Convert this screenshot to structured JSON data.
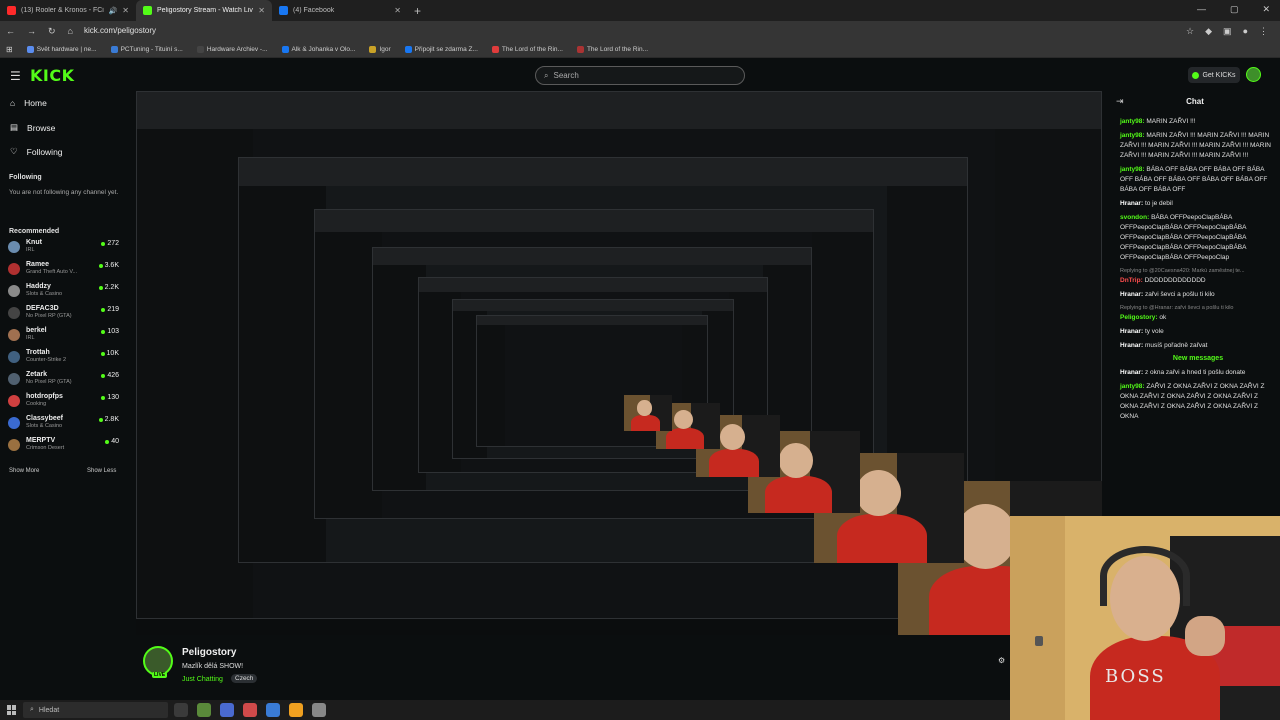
{
  "browser": {
    "tabs": [
      {
        "title": "(13) Rooler & Kronos - FCi",
        "active": false,
        "fav": "#ff2a2a",
        "audio": true
      },
      {
        "title": "Peligostory Stream - Watch Liv",
        "active": true,
        "fav": "#53fc18",
        "audio": false
      },
      {
        "title": "(4) Facebook",
        "active": false,
        "fav": "#1877f2",
        "audio": false
      }
    ],
    "url": "kick.com/peligostory",
    "bookmarks": [
      {
        "label": "Svět hardware | ne...",
        "color": "#5b8def"
      },
      {
        "label": "PCTuning - Tituiní s...",
        "color": "#3a7bd5"
      },
      {
        "label": "Hardware Archiev -...",
        "color": "#444"
      },
      {
        "label": "Alk & Johanka v Olo...",
        "color": "#1877f2"
      },
      {
        "label": "Igor",
        "color": "#c9a227"
      },
      {
        "label": "Připojit se zdarma Z...",
        "color": "#1877f2"
      },
      {
        "label": "The Lord of the Rin...",
        "color": "#e03c3c"
      },
      {
        "label": "The Lord of the Rin...",
        "color": "#a33"
      }
    ]
  },
  "header": {
    "logo": "KICK",
    "search_placeholder": "Search",
    "get_kicks": "Get KICKs"
  },
  "sidebar": {
    "nav": [
      {
        "label": "Home",
        "icon": "home-icon"
      },
      {
        "label": "Browse",
        "icon": "browse-icon"
      },
      {
        "label": "Following",
        "icon": "heart-icon"
      }
    ],
    "following_title": "Following",
    "not_following": "You are not following any channel yet.",
    "recommended_title": "Recommended",
    "recommended": [
      {
        "name": "Knut",
        "category": "IRL",
        "viewers": "272",
        "color": "#6a8caf"
      },
      {
        "name": "Ramee",
        "category": "Grand Theft Auto V...",
        "viewers": "3.6K",
        "color": "#b03030"
      },
      {
        "name": "Haddzy",
        "category": "Slots & Casino",
        "viewers": "2.2K",
        "color": "#8a8a8a"
      },
      {
        "name": "DEFAC3D",
        "category": "No Pixel RP (GTA)",
        "viewers": "219",
        "color": "#444"
      },
      {
        "name": "berkel",
        "category": "IRL",
        "viewers": "103",
        "color": "#a07050"
      },
      {
        "name": "Trottah",
        "category": "Counter-Strike 2",
        "viewers": "10K",
        "color": "#406080"
      },
      {
        "name": "Zetark",
        "category": "No Pixel RP (GTA)",
        "viewers": "426",
        "color": "#506070"
      },
      {
        "name": "hotdropfps",
        "category": "Cooking",
        "viewers": "130",
        "color": "#d04040"
      },
      {
        "name": "Classybeef",
        "category": "Slots & Casino",
        "viewers": "2.8K",
        "color": "#3a6ad0"
      },
      {
        "name": "MERPTV",
        "category": "Crimson Desert",
        "viewers": "40",
        "color": "#9a7040"
      }
    ],
    "show_more": "Show More",
    "show_less": "Show Less"
  },
  "chat": {
    "title": "Chat",
    "messages": [
      {
        "user": "janty98:",
        "color": "#53fc18",
        "text": "MARIN ZAŘVI !!!"
      },
      {
        "user": "janty98:",
        "color": "#53fc18",
        "text": "MARIN ZAŘVI !!! MARIN ZAŘVI !!! MARIN ZAŘVI !!! MARIN ZAŘVI !!! MARIN ZAŘVI !!! MARIN ZAŘVI !!! MARIN ZAŘVI !!! MARIN ZAŘVI !!!"
      },
      {
        "user": "janty98:",
        "color": "#53fc18",
        "text": "BÁBA OFF BÁBA OFF BÁBA OFF BÁBA OFF BÁBA OFF BÁBA OFF BÁBA OFF BÁBA OFF BÁBA OFF BÁBA OFF"
      },
      {
        "user": "Hranar:",
        "color": "#ffffff",
        "text": "to je debil"
      },
      {
        "user": "svondon:",
        "color": "#53fc18",
        "text": "BÁBA OFFPeepoClapBÁBA OFFPeepoClapBÁBA OFFPeepoClapBÁBA OFFPeepoClapBÁBA OFFPeepoClapBÁBA OFFPeepoClapBÁBA OFFPeepoClapBÁBA OFFPeepoClapBÁBA OFFPeepoClap"
      },
      {
        "reply": "Replying to @20Caesna420: Markú zaměstnej te..."
      },
      {
        "user": "DnTrip:",
        "color": "#ff4d4d",
        "text": "DDDDDDDDDDDDD"
      },
      {
        "user": "Hranar:",
        "color": "#ffffff",
        "text": "zařvi ševci a pošlu ti kilo"
      },
      {
        "reply": "Replying to @Hranar: zařvi ševci a pošlu ti kilo"
      },
      {
        "user": "Peligostory:",
        "color": "#53fc18",
        "text": "ok"
      },
      {
        "user": "Hranar:",
        "color": "#ffffff",
        "text": "ty vole"
      },
      {
        "user": "Hranar:",
        "color": "#ffffff",
        "text": "musíš pořadně zařvat"
      },
      {
        "divider": "New messages"
      },
      {
        "user": "Hranar:",
        "color": "#ffffff",
        "text": "z okna zařvi a hned ti pošlu donate"
      },
      {
        "user": "janty98:",
        "color": "#53fc18",
        "text": "ZAŘVI Z OKNA ZAŘVI Z OKNA ZAŘVI Z OKNA ZAŘVI Z OKNA ZAŘVI Z OKNA ZAŘVI Z OKNA ZAŘVI Z OKNA ZAŘVI Z OKNA ZAŘVI Z OKNA"
      }
    ]
  },
  "stream": {
    "name": "Peligostory",
    "title": "Mazlík dělá SHOW!",
    "category": "Just Chatting",
    "tag": "Czech",
    "live": "LIVE"
  },
  "taskbar": {
    "search_placeholder": "Hledat",
    "apps": [
      "#3a3a3a",
      "#5a8a3a",
      "#4a6ad0",
      "#d04a4a",
      "#3a7bd5",
      "#f0a020",
      "#888"
    ]
  }
}
